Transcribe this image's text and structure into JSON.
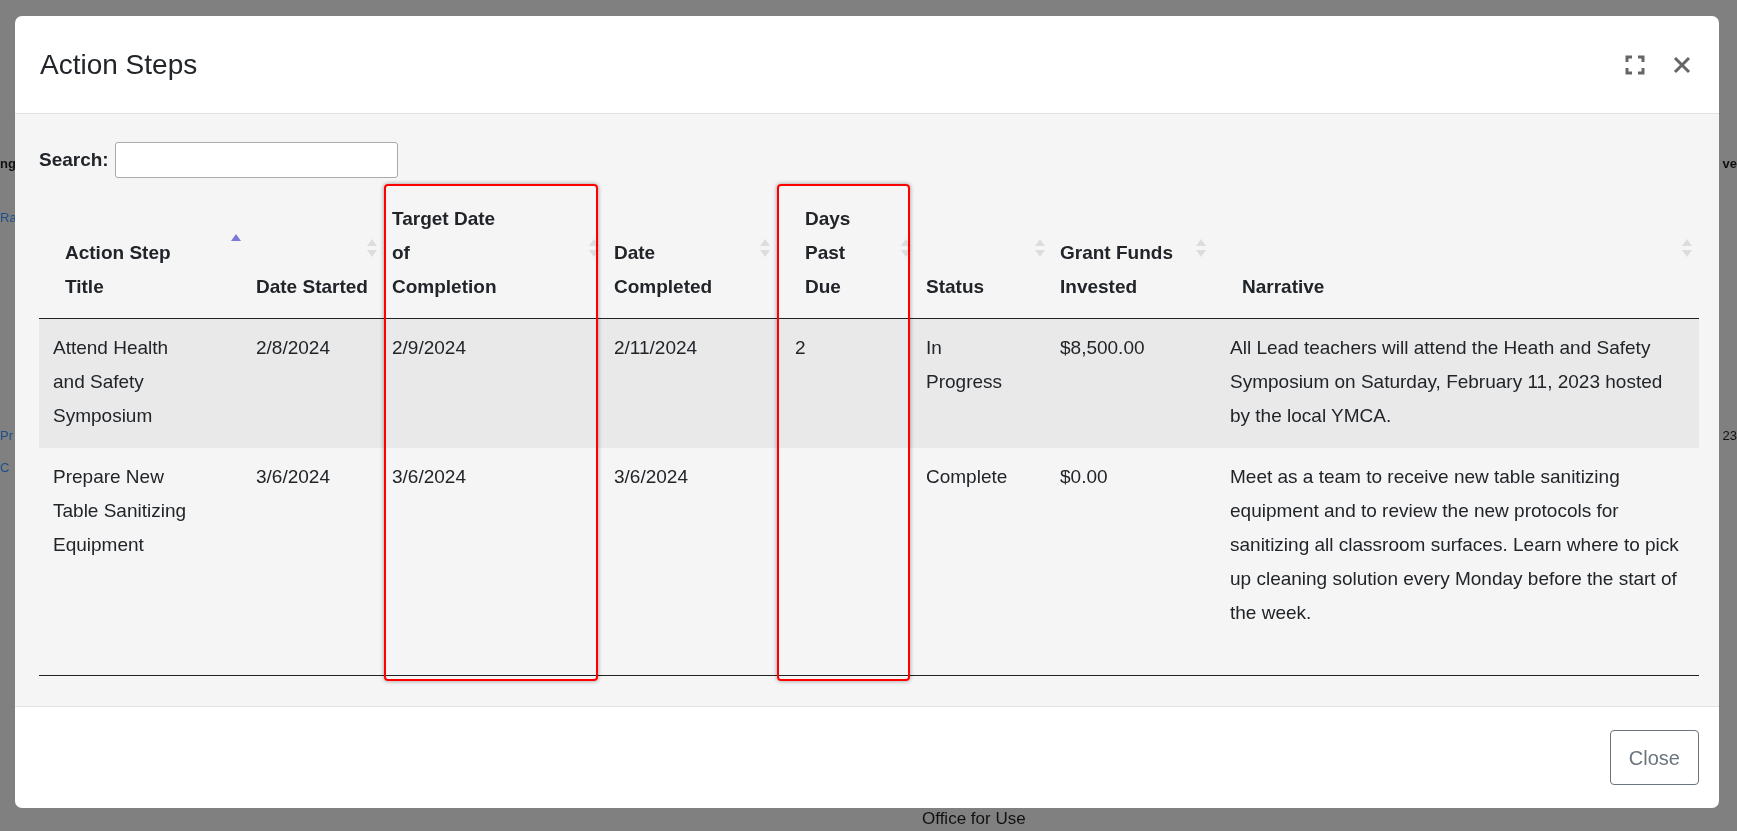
{
  "background_fragments": [
    {
      "text": "ng",
      "kind": "heading"
    },
    {
      "text": "Ra",
      "kind": "link"
    },
    {
      "text": "Pr",
      "kind": "link"
    },
    {
      "text": "C",
      "kind": "link"
    },
    {
      "text": "ve",
      "kind": "heading"
    },
    {
      "text": "23",
      "kind": "text"
    },
    {
      "text": "Office for Use",
      "kind": "text"
    }
  ],
  "modal": {
    "title": "Action Steps",
    "search": {
      "label": "Search:"
    },
    "table": {
      "columns": [
        {
          "label": "Action Step Title",
          "sorted": true,
          "highlighted": false
        },
        {
          "label": "Date Started",
          "sorted": false,
          "highlighted": false
        },
        {
          "label": "Target Date of Completion",
          "sorted": false,
          "highlighted": true
        },
        {
          "label": "Date Completed",
          "sorted": false,
          "highlighted": false
        },
        {
          "label": "Days Past Due",
          "sorted": false,
          "highlighted": true
        },
        {
          "label": "Status",
          "sorted": false,
          "highlighted": false
        },
        {
          "label": "Grant Funds Invested",
          "sorted": false,
          "highlighted": false
        },
        {
          "label": "Narrative",
          "sorted": false,
          "highlighted": false
        }
      ],
      "rows": [
        {
          "cells": [
            "Attend Health and Safety Symposium",
            "2/8/2024",
            "2/9/2024",
            "2/11/2024",
            "2",
            "In Progress",
            "$8,500.00",
            "All Lead teachers will attend the Heath and Safety Symposium on Saturday, February 11, 2023 hosted by the local YMCA."
          ]
        },
        {
          "cells": [
            "Prepare New Table Sanitizing Equipment",
            "3/6/2024",
            "3/6/2024",
            "3/6/2024",
            "",
            "Complete",
            "$0.00",
            "Meet as a team to receive new table sanitizing equipment and to review the new protocols for sanitizing all classroom surfaces. Learn where to pick up cleaning solution every Monday before the start of the week."
          ]
        }
      ]
    },
    "buttons": [
      "Close"
    ]
  }
}
